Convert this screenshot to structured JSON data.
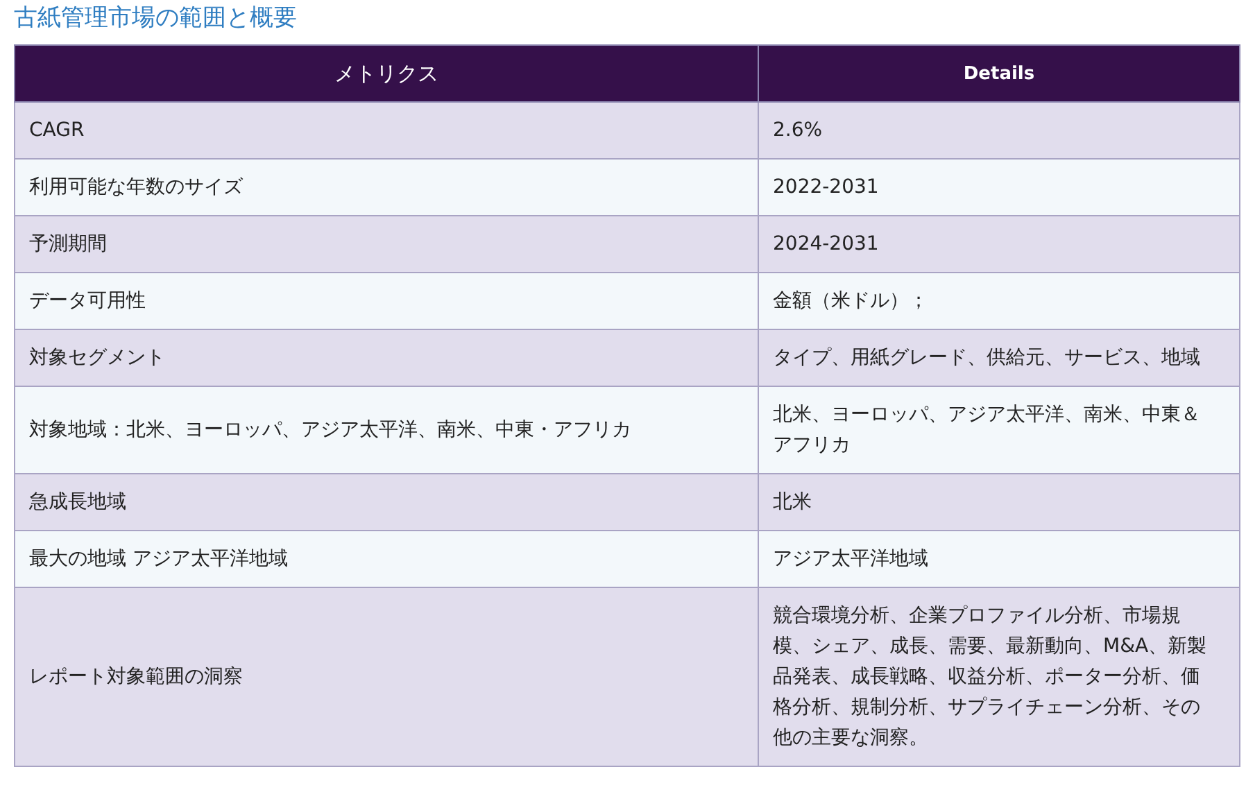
{
  "title": "古紙管理市場の範囲と概要",
  "table": {
    "columns": [
      "メトリクス",
      "Details"
    ],
    "rows": [
      {
        "metric": "CAGR",
        "details": "2.6%"
      },
      {
        "metric": "利用可能な年数のサイズ",
        "details": "2022-2031"
      },
      {
        "metric": "予測期間",
        "details": "2024-2031"
      },
      {
        "metric": "データ可用性",
        "details": "金額（米ドル）；"
      },
      {
        "metric": "対象セグメント",
        "details": "タイプ、用紙グレード、供給元、サービス、地域"
      },
      {
        "metric": "対象地域：北米、ヨーロッパ、アジア太平洋、南米、中東・アフリカ",
        "details": "北米、ヨーロッパ、アジア太平洋、南米、中東＆アフリカ"
      },
      {
        "metric": "急成長地域",
        "details": "北米"
      },
      {
        "metric": "最大の地域 アジア太平洋地域",
        "details": "アジア太平洋地域"
      },
      {
        "metric": "レポート対象範囲の洞察",
        "details": "競合環境分析、企業プロファイル分析、市場規模、シェア、成長、需要、最新動向、M&A、新製品発表、成長戦略、収益分析、ポーター分析、価格分析、規制分析、サプライチェーン分析、その他の主要な洞察。"
      }
    ]
  }
}
